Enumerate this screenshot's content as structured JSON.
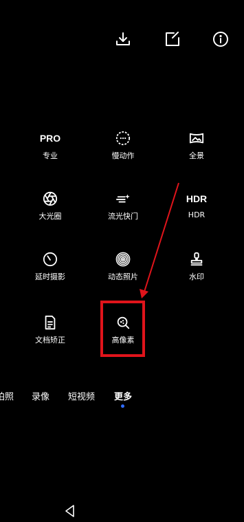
{
  "top_bar": {
    "download_icon": "download-icon",
    "edit_icon": "edit-icon",
    "info_icon": "info-icon"
  },
  "modes": [
    {
      "id": "pro",
      "icon_text": "PRO",
      "label": "专业"
    },
    {
      "id": "slowmo",
      "icon": "slow-motion-icon",
      "label": "慢动作"
    },
    {
      "id": "panorama",
      "icon": "panorama-icon",
      "label": "全景"
    },
    {
      "id": "aperture",
      "icon": "aperture-icon",
      "label": "大光圈"
    },
    {
      "id": "lightpainting",
      "icon": "light-painting-icon",
      "label": "流光快门"
    },
    {
      "id": "hdr",
      "icon_text": "HDR",
      "label": "HDR"
    },
    {
      "id": "timelapse",
      "icon": "timelapse-icon",
      "label": "延时摄影"
    },
    {
      "id": "moving",
      "icon": "moving-picture-icon",
      "label": "动态照片"
    },
    {
      "id": "watermark",
      "icon": "watermark-icon",
      "label": "水印"
    },
    {
      "id": "document",
      "icon": "document-icon",
      "label": "文档矫正"
    },
    {
      "id": "highres",
      "icon": "high-resolution-icon",
      "label": "高像素"
    }
  ],
  "tabs": [
    {
      "label": "拍照",
      "active": false
    },
    {
      "label": "录像",
      "active": false
    },
    {
      "label": "短视频",
      "active": false
    },
    {
      "label": "更多",
      "active": true
    }
  ],
  "colors": {
    "highlight": "#e0141b",
    "active_dot": "#2f6bff"
  }
}
